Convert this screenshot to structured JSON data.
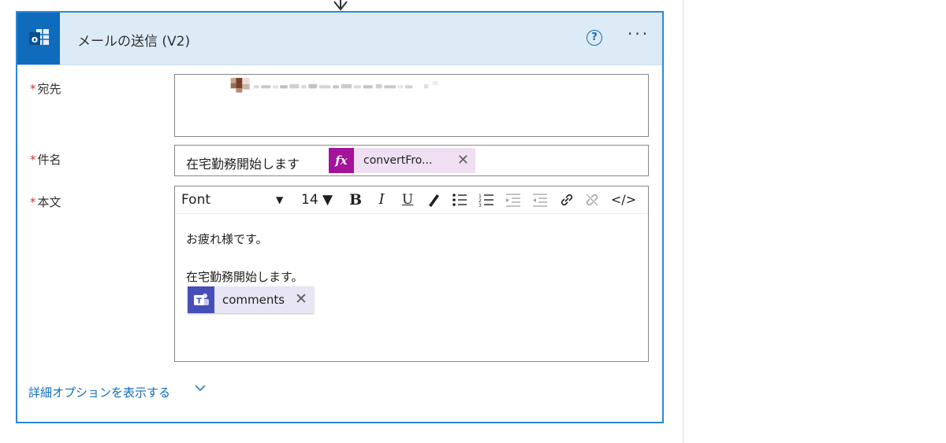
{
  "card": {
    "title": "メールの送信 (V2)",
    "help_symbol": "?",
    "more_symbol": "···"
  },
  "fields": {
    "to_label": "宛先",
    "subject_label": "件名",
    "body_label": "本文",
    "required_mark": "*"
  },
  "subject": {
    "text": "在宅勤務開始します",
    "token_icon": "fx",
    "token_label": "convertFro...",
    "token_remove": "✕"
  },
  "toolbar": {
    "font": "Font",
    "font_caret": "▼",
    "size": "14 ▼",
    "bold": "B",
    "italic": "I",
    "underline": "U",
    "code": "</>"
  },
  "body": {
    "line1": "お疲れ様です。",
    "line2": "在宅勤務開始します。",
    "token_label": "comments",
    "token_remove": "✕"
  },
  "advanced": {
    "link": "詳細オプションを表示する"
  },
  "colors": {
    "accent": "#0f6cbd",
    "card_border": "#2b88d8",
    "header_bg": "#ddebf7",
    "expression_token": "#a4139c",
    "teams_token": "#464eb8"
  },
  "icons": {
    "app": "outlook-icon",
    "expression": "fx-icon",
    "teams": "teams-icon"
  }
}
